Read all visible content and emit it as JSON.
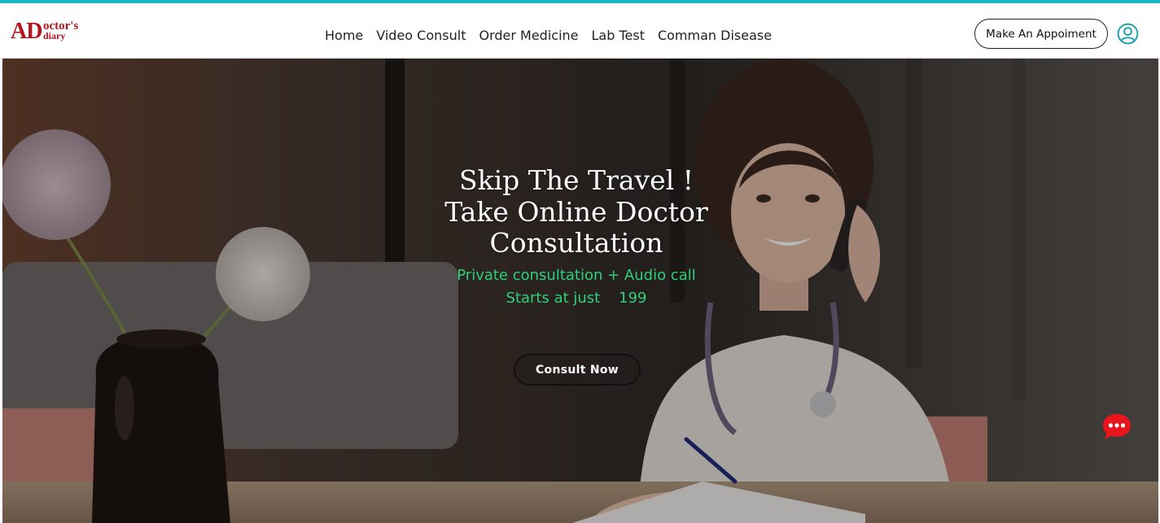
{
  "colors": {
    "accent_top_bar": "#17b8c4",
    "logo_red": "#b5121b",
    "subtitle_green": "#2fd07a",
    "chat_red": "#e8151d",
    "user_icon_teal": "#1aa1b0"
  },
  "logo": {
    "big": "AD",
    "top": "octor's",
    "bottom": "diary"
  },
  "nav": {
    "items": [
      {
        "label": "Home"
      },
      {
        "label": "Video Consult"
      },
      {
        "label": "Order Medicine"
      },
      {
        "label": "Lab Test"
      },
      {
        "label": "Comman Disease"
      }
    ]
  },
  "header": {
    "appointment_button": "Make An Appoiment",
    "user_icon": "user-circle-icon"
  },
  "hero": {
    "headline_line1": "Skip The Travel !",
    "headline_line2": "Take Online Doctor",
    "headline_line3": "Consultation",
    "sub_line1": "Private consultation + Audio call",
    "sub_line2": "Starts at just    199",
    "cta_label": "Consult Now",
    "image_subject": "smiling doctor talking on phone at desk"
  },
  "chat_widget": {
    "icon": "chat-bubble-icon"
  }
}
